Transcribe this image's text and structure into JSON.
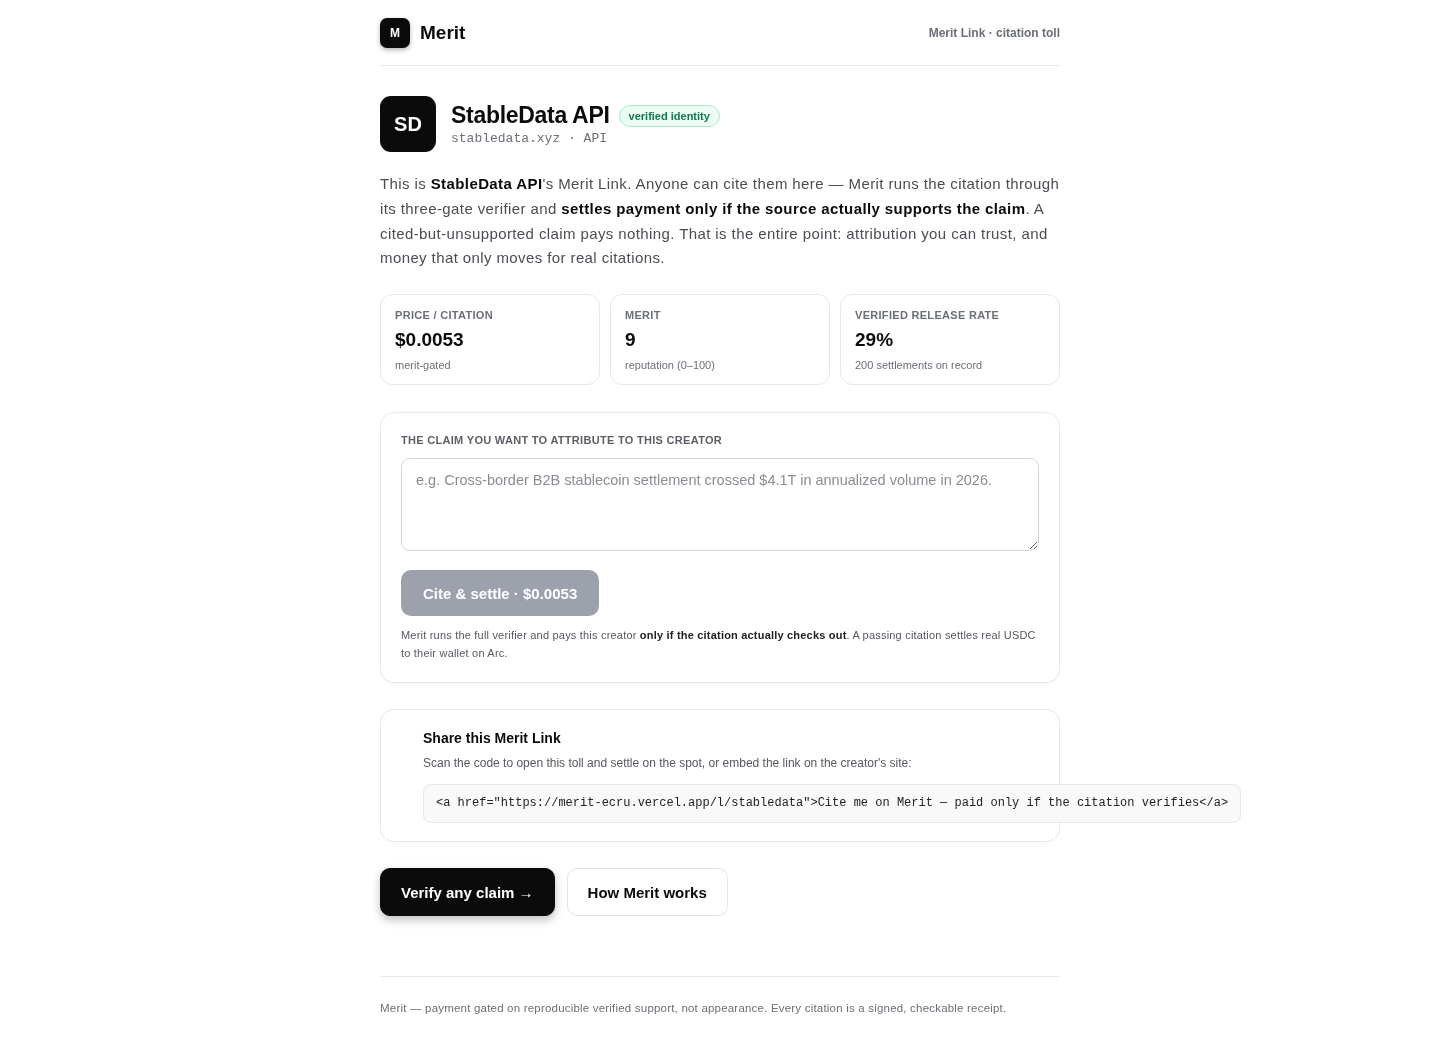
{
  "header": {
    "logo_letter": "M",
    "brand": "Merit",
    "tagline": "Merit Link · citation toll"
  },
  "profile": {
    "initials": "SD",
    "name": "StableData API",
    "badge": "verified identity",
    "subtitle": "stabledata.xyz · API"
  },
  "intro": "This is **StableData API**'s Merit Link. Anyone can cite them here — Merit runs the citation through its three-gate verifier and **settles payment only if the source actually supports the claim**. A cited-but-unsupported claim pays nothing. That is the entire point: attribution you can trust, and money that only moves for real citations.",
  "stats": [
    {
      "label": "PRICE / CITATION",
      "value": "$0.0053",
      "note": "merit-gated"
    },
    {
      "label": "MERIT",
      "value": "9",
      "note": "reputation (0–100)"
    },
    {
      "label": "VERIFIED RELEASE RATE",
      "value": "29%",
      "note": "200 settlements on record"
    }
  ],
  "claim_form": {
    "label": "THE CLAIM YOU WANT TO ATTRIBUTE TO THIS CREATOR",
    "placeholder": "e.g. Cross-border B2B stablecoin settlement crossed $4.1T in annualized volume in 2026.",
    "submit": {
      "label": "Cite & settle · $0.0053",
      "disabled": true
    },
    "note": "Merit runs the full verifier and pays this creator **only if the citation actually checks out**. A passing citation settles real USDC to their wallet on Arc."
  },
  "share": {
    "title": "Share this Merit Link",
    "description": "Scan the code to open this toll and settle on the spot, or embed the link on the creator's site:",
    "embed_code": "<a href=\"https://merit-ecru.vercel.app/l/stabledata\">Cite me on Merit — paid only if the citation verifies</a>"
  },
  "actions": [
    {
      "label": "Verify any claim →",
      "kind": "primary"
    },
    {
      "label": "How Merit works",
      "kind": "secondary"
    }
  ],
  "footer": "Merit — payment gated on reproducible verified support, not appearance. Every citation is a signed, checkable receipt."
}
